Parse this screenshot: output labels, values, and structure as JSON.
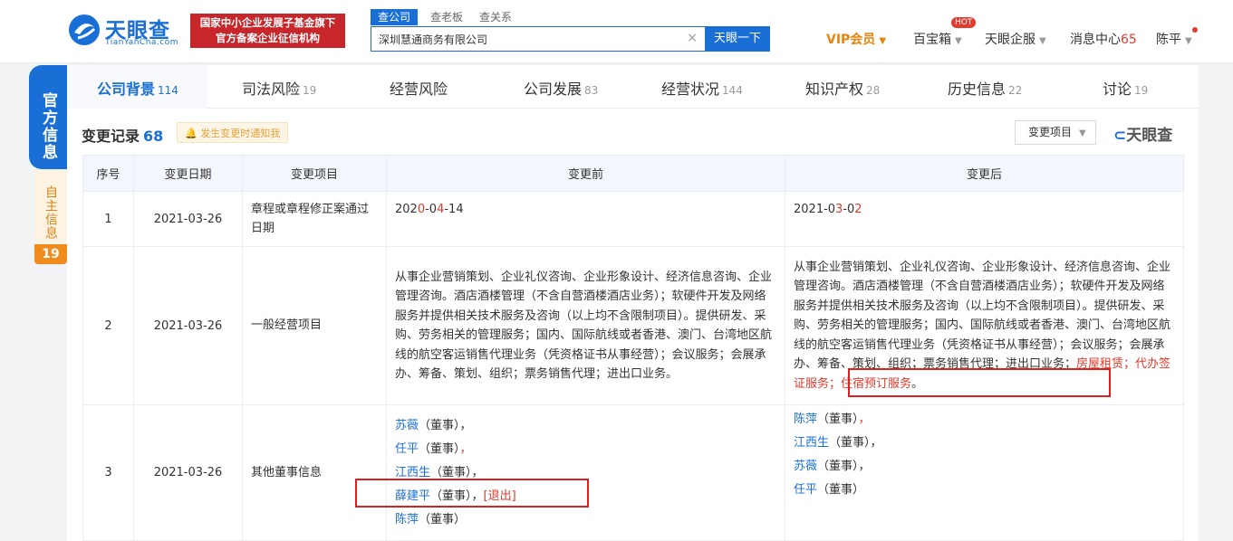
{
  "header": {
    "logo_text": "天眼查",
    "logo_sub": "TianYanCha.com",
    "badge_line1": "国家中小企业发展子基金旗下",
    "badge_line2": "官方备案企业征信机构",
    "search_tabs": [
      "查公司",
      "查老板",
      "查关系"
    ],
    "search_value": "深圳慧通商务有限公司",
    "search_clear": "×",
    "search_button": "天眼一下",
    "vip": "VIP会员",
    "baibaoxiang": "百宝箱",
    "hot": "HOT",
    "qifu": "天眼企服",
    "messages": "消息中心",
    "messages_count": "65",
    "user": "陈平"
  },
  "side": {
    "main": "官方信息",
    "sub": "自主信息",
    "sub_count": "19"
  },
  "tabs": [
    {
      "label": "公司背景",
      "count": "114"
    },
    {
      "label": "司法风险",
      "count": "19"
    },
    {
      "label": "经营风险",
      "count": ""
    },
    {
      "label": "公司发展",
      "count": "83"
    },
    {
      "label": "经营状况",
      "count": "144"
    },
    {
      "label": "知识产权",
      "count": "28"
    },
    {
      "label": "历史信息",
      "count": "22"
    },
    {
      "label": "讨论",
      "count": "19"
    }
  ],
  "section": {
    "title": "变更记录",
    "count": "68",
    "notify": "发生变更时通知我",
    "filter": "变更项目",
    "watermark": "天眼查"
  },
  "table": {
    "headers": [
      "序号",
      "变更日期",
      "变更项目",
      "变更前",
      "变更后"
    ],
    "rows": [
      {
        "no": "1",
        "date": "2021-03-26",
        "item": "章程或章程修正案通过日期",
        "before_a": "202",
        "before_b": "0",
        "before_c": "-0",
        "before_d": "4",
        "before_e": "-14",
        "after_a": "2021-0",
        "after_b": "3",
        "after_c": "-0",
        "after_d": "2"
      },
      {
        "no": "2",
        "date": "2021-03-26",
        "item": "一般经营项目",
        "before": "从事企业营销策划、企业礼仪咨询、企业形象设计、经济信息咨询、企业管理咨询。酒店酒楼管理（不含自营酒楼酒店业务）；软硬件开发及网络服务并提供相关技术服务及咨询（以上均不含限制项目）。提供研发、采购、劳务相关的管理服务；国内、国际航线或者香港、澳门、台湾地区航线的航空客运销售代理业务（凭资格证书从事经营）；会议服务；会展承办、筹备、策划、组织；票务销售代理；进出口业务。",
        "after_main": "从事企业营销策划、企业礼仪咨询、企业形象设计、经济信息咨询、企业管理咨询。酒店酒楼管理（不含自营酒楼酒店业务）；软硬件开发及网络服务并提供相关技术服务及咨询（以上均不含限制项目）。提供研发、采购、劳务相关的管理服务；国内、国际航线或者香港、澳门、台湾地区航线的航空客运销售代理业务（凭资格证书从事经营）；会议服务；会展承办、筹备、策划、组织；票务销售代理；进出口业务；",
        "after_added": "房屋租赁；代办签证服务；住宿预订服务",
        "after_end": "。"
      },
      {
        "no": "3",
        "date": "2021-03-26",
        "item": "其他董事信息",
        "before_people": [
          {
            "name": "苏薇",
            "role": "（董事）",
            "sep": "，",
            "tag": ""
          },
          {
            "name": "任平",
            "role": "（董事）",
            "sep": "，",
            "tag": ""
          },
          {
            "name": "江西生",
            "role": "（董事）",
            "sep": "，",
            "tag": ""
          },
          {
            "name": "薛建平",
            "role": "（董事）",
            "sep": "，",
            "tag": "[退出]"
          },
          {
            "name": "陈萍",
            "role": "（董事）",
            "sep": "",
            "tag": ""
          }
        ],
        "after_people": [
          {
            "name": "陈萍",
            "role": "（董事）",
            "sep": "，"
          },
          {
            "name": "江西生",
            "role": "（董事）",
            "sep": "，"
          },
          {
            "name": "苏薇",
            "role": "（董事）",
            "sep": "，"
          },
          {
            "name": "任平",
            "role": "（董事）",
            "sep": ""
          }
        ]
      }
    ]
  }
}
